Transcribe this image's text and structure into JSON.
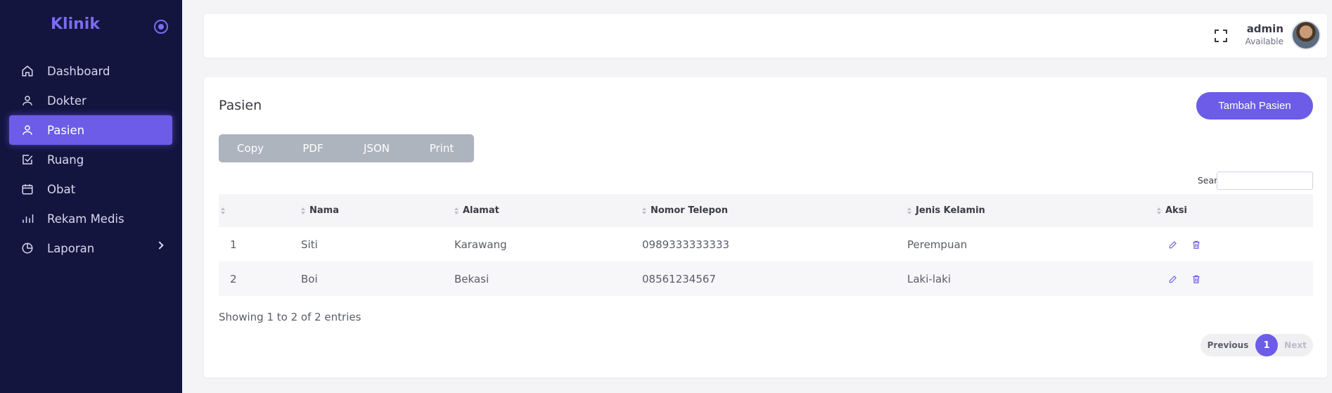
{
  "sidebar": {
    "brand": "Klinik",
    "items": [
      {
        "label": "Dashboard",
        "icon": "home-icon"
      },
      {
        "label": "Dokter",
        "icon": "user-icon"
      },
      {
        "label": "Pasien",
        "icon": "user-icon",
        "active": true
      },
      {
        "label": "Ruang",
        "icon": "checkbox-icon"
      },
      {
        "label": "Obat",
        "icon": "calendar-icon"
      },
      {
        "label": "Rekam Medis",
        "icon": "bar-chart-icon"
      },
      {
        "label": "Laporan",
        "icon": "pie-chart-icon"
      }
    ]
  },
  "header": {
    "user_name": "admin",
    "user_status": "Available"
  },
  "page": {
    "title": "Pasien",
    "add_button": "Tambah Pasien",
    "export_buttons": [
      "Copy",
      "PDF",
      "JSON",
      "Print"
    ],
    "search_label": "Search:",
    "search_value": ""
  },
  "table": {
    "columns": [
      "",
      "Nama",
      "Alamat",
      "Nomor Telepon",
      "Jenis Kelamin",
      "Aksi"
    ],
    "rows": [
      [
        "1",
        "Siti",
        "Karawang",
        "0989333333333",
        "Perempuan"
      ],
      [
        "2",
        "Boi",
        "Bekasi",
        "08561234567",
        "Laki-laki"
      ]
    ]
  },
  "footer": {
    "entries_info": "Showing 1 to 2 of 2 entries",
    "prev": "Previous",
    "current_page": "1",
    "next": "Next"
  },
  "colors": {
    "sidebar_bg": "#13153f",
    "accent": "#6c5ce7",
    "export_bg": "#aeb4bd"
  }
}
